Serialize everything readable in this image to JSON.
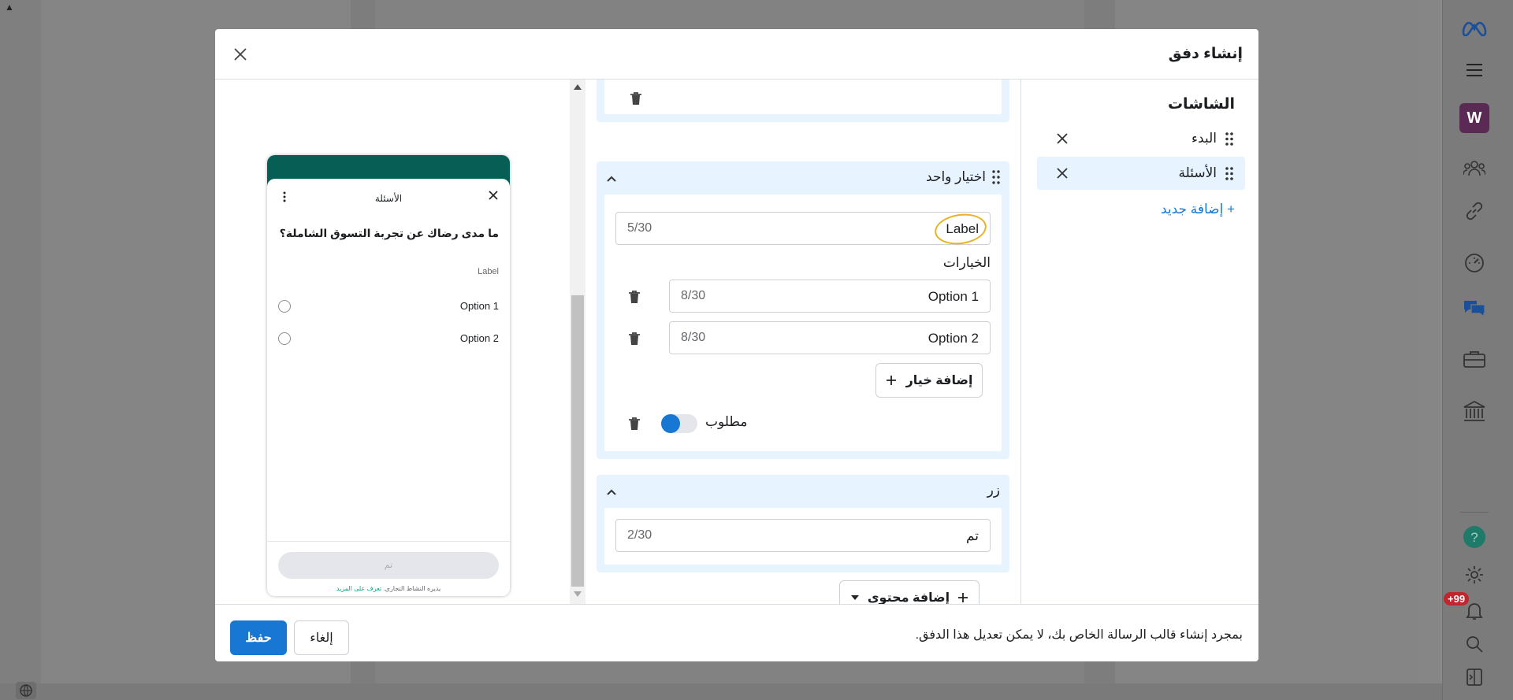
{
  "modal": {
    "title": "إنشاء دفق",
    "footer_note": "بمجرد إنشاء قالب الرسالة الخاص بك، لا يمكن تعديل هذا الدفق.",
    "save_label": "حفظ",
    "cancel_label": "إلغاء"
  },
  "screens": {
    "title": "الشاشات",
    "items": [
      {
        "label": "البدء",
        "active": false
      },
      {
        "label": "الأسئلة",
        "active": true
      }
    ],
    "add_new_label": "+ إضافة جديد"
  },
  "editor": {
    "single_choice": {
      "title": "اختيار واحد",
      "label_value": "Label",
      "label_count": "5/30",
      "options_title": "الخيارات",
      "options": [
        {
          "value": "Option 1",
          "count": "8/30"
        },
        {
          "value": "Option 2",
          "count": "8/30"
        }
      ],
      "add_option_label": "إضافة خيار",
      "required_label": "مطلوب",
      "required_on": true
    },
    "button_card": {
      "title": "زر",
      "value": "تم",
      "count": "2/30"
    },
    "add_content_label": "إضافة محتوى"
  },
  "preview": {
    "title": "الأسئلة",
    "question": "ما مدى رضاك عن تجربة التسوق الشاملة؟",
    "label": "Label",
    "options": [
      "Option 1",
      "Option 2"
    ],
    "button_label": "تم",
    "footer_text": "يديره النشاط التجاري.",
    "footer_link": "تعرف على المزيد"
  },
  "rail": {
    "avatar_letter": "W",
    "badge": "+99"
  },
  "colors": {
    "accent": "#1877d2",
    "selected_bg": "#e7f3ff",
    "whatsapp_green": "#075e54",
    "highlight": "#e6b422"
  }
}
